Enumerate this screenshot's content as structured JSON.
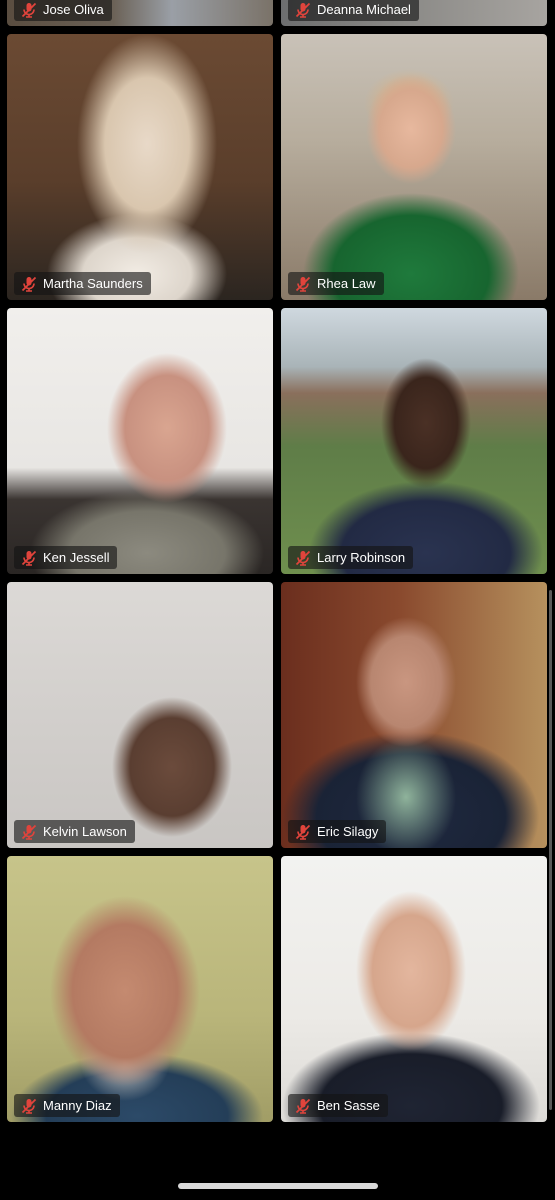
{
  "participants": [
    {
      "name": "Jose Oliva",
      "muted": true
    },
    {
      "name": "Deanna Michael",
      "muted": true
    },
    {
      "name": "Martha Saunders",
      "muted": true
    },
    {
      "name": "Rhea Law",
      "muted": true
    },
    {
      "name": "Ken Jessell",
      "muted": true
    },
    {
      "name": "Larry Robinson",
      "muted": true
    },
    {
      "name": "Kelvin Lawson",
      "muted": true
    },
    {
      "name": "Eric Silagy",
      "muted": true
    },
    {
      "name": "Manny Diaz",
      "muted": true
    },
    {
      "name": "Ben Sasse",
      "muted": true
    }
  ],
  "colors": {
    "background": "#000000",
    "muted_icon": "#e0443c",
    "label_bg": "rgba(20,20,20,0.62)",
    "label_text": "#ffffff"
  },
  "icons": {
    "muted": "mic-off-icon"
  }
}
